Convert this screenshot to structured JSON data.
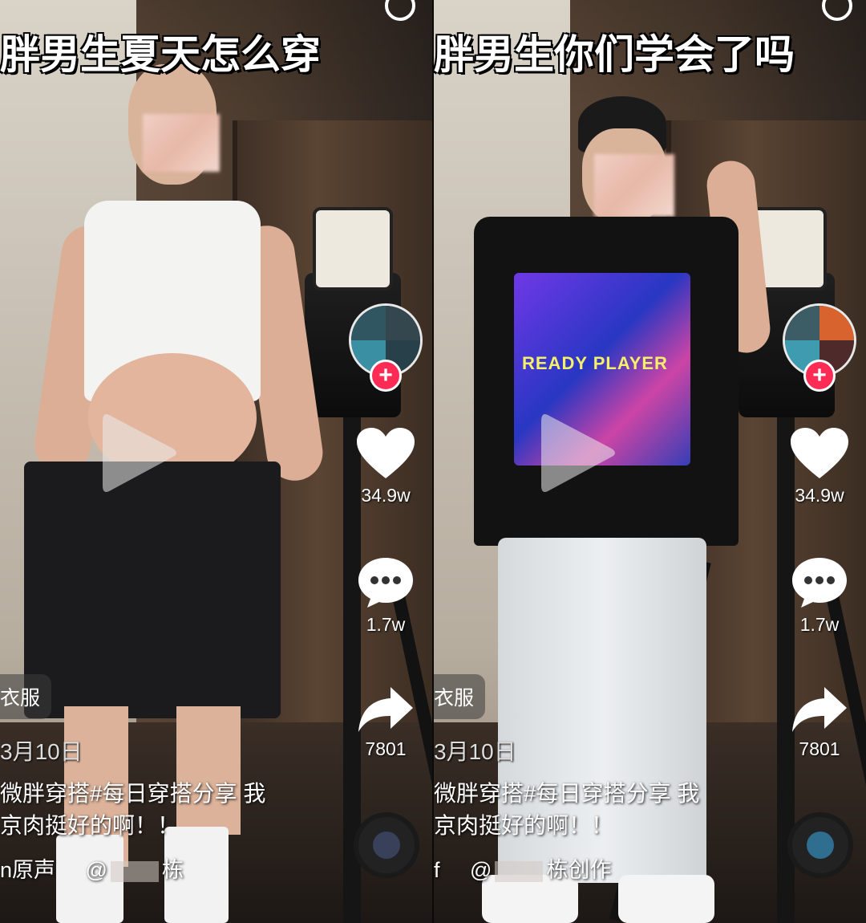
{
  "panels": [
    {
      "title": "胖男生夏天怎么穿",
      "likes": "34.9w",
      "comments": "1.7w",
      "shares": "7801",
      "music_tag": "衣服",
      "date": "3月10日",
      "caption_line1": "微胖穿搭#每日穿搭分享  我",
      "caption_line2": "京肉挺好的啊！！",
      "sound_prefix": "n原声",
      "sound_at": "@",
      "sound_suffix": "栋",
      "follow": "+",
      "avatar_colors": [
        "#2f5661",
        "#34464e",
        "#3b8fa3",
        "#274049"
      ],
      "disc_color": "#39405a"
    },
    {
      "title": "胖男生你们学会了吗",
      "likes": "34.9w",
      "comments": "1.7w",
      "shares": "7801",
      "music_tag": "衣服",
      "date": "3月10日",
      "caption_line1": "微胖穿搭#每日穿搭分享  我",
      "caption_line2": "京肉挺好的啊！！",
      "sound_prefix": "f",
      "sound_at": "@",
      "sound_suffix": "栋创作",
      "follow": "+",
      "avatar_colors": [
        "#3c5d66",
        "#d9632e",
        "#3f9bb0",
        "#4e2a2a"
      ],
      "disc_color": "#2f6e8f"
    }
  ],
  "colors": {
    "accent_follow": "#fe2c55",
    "text": "#ffffff"
  },
  "icons": [
    "search-icon",
    "heart-icon",
    "comment-icon",
    "share-icon",
    "play-icon",
    "plus-icon",
    "music-disc-icon"
  ]
}
